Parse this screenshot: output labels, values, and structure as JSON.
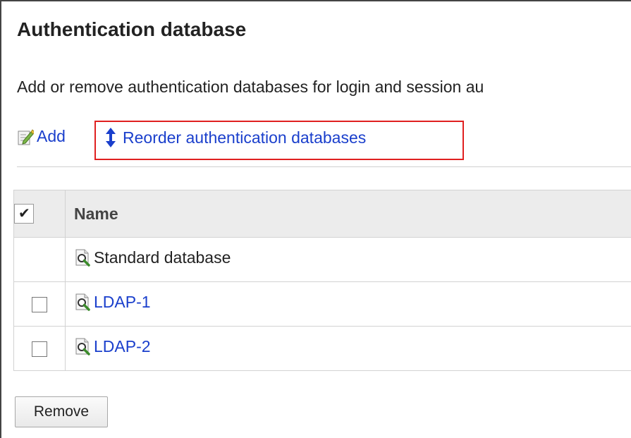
{
  "page": {
    "title": "Authentication database",
    "description": "Add or remove authentication databases for login and session au"
  },
  "toolbar": {
    "add_label": "Add",
    "add_icon": "edit-document-icon",
    "reorder_label": "Reorder authentication databases",
    "reorder_icon": "up-down-arrow-icon",
    "highlight_color": "#e02020"
  },
  "table": {
    "header": {
      "check_symbol": "✔",
      "name_label": "Name"
    },
    "rows": [
      {
        "name": "Standard database",
        "icon": "database-search-icon",
        "selectable": false,
        "checked": false,
        "is_link": false
      },
      {
        "name": "LDAP-1",
        "icon": "database-search-icon",
        "selectable": true,
        "checked": false,
        "is_link": true
      },
      {
        "name": "LDAP-2",
        "icon": "database-search-icon",
        "selectable": true,
        "checked": false,
        "is_link": true
      }
    ]
  },
  "actions": {
    "remove_label": "Remove"
  },
  "colors": {
    "link": "#1a3fcc",
    "header_bg": "#ececec",
    "border": "#d2d2d2"
  }
}
